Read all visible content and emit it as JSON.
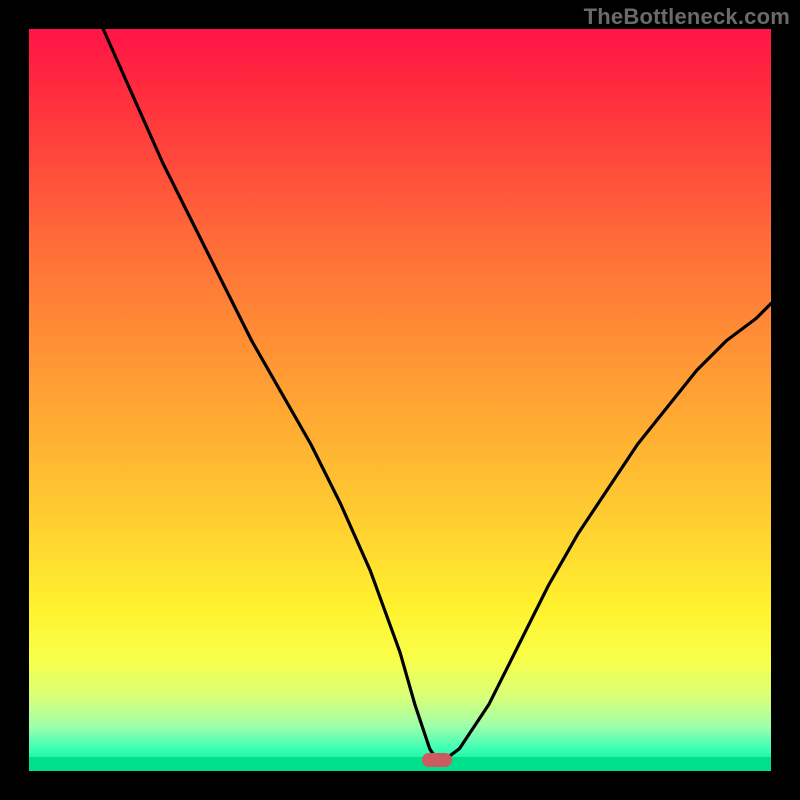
{
  "watermark": "TheBottleneck.com",
  "chart_data": {
    "type": "line",
    "title": "",
    "xlabel": "",
    "ylabel": "",
    "xlim": [
      0,
      100
    ],
    "ylim": [
      0,
      100
    ],
    "grid": false,
    "legend": false,
    "background_gradient": "red-to-green vertical",
    "marker": {
      "x": 55,
      "y": 1.5,
      "color": "#cc5b60"
    },
    "series": [
      {
        "name": "bottleneck-curve",
        "color": "#000000",
        "x": [
          10,
          14,
          18,
          22,
          26,
          30,
          34,
          38,
          42,
          46,
          50,
          52,
          54,
          55,
          56,
          58,
          62,
          66,
          70,
          74,
          78,
          82,
          86,
          90,
          94,
          98,
          100
        ],
        "y": [
          100,
          91,
          82,
          74,
          66,
          58,
          51,
          44,
          36,
          27,
          16,
          9,
          3,
          1.5,
          1.5,
          3,
          9,
          17,
          25,
          32,
          38,
          44,
          49,
          54,
          58,
          61,
          63
        ]
      }
    ]
  },
  "layout": {
    "plot_left": 29,
    "plot_top": 29,
    "plot_size": 742
  }
}
